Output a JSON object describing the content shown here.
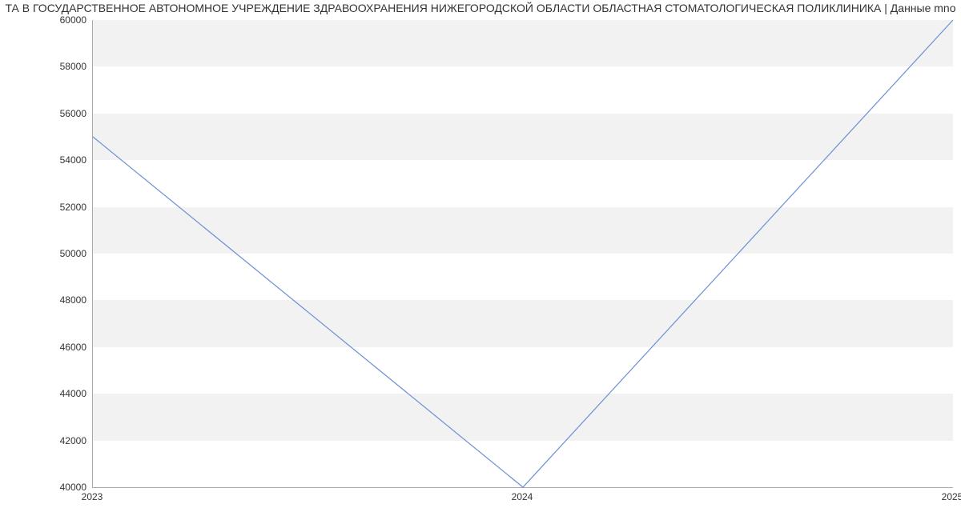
{
  "chart_data": {
    "type": "line",
    "title": "ТА В ГОСУДАРСТВЕННОЕ АВТОНОМНОЕ УЧРЕЖДЕНИЕ ЗДРАВООХРАНЕНИЯ НИЖЕГОРОДСКОЙ ОБЛАСТИ ОБЛАСТНАЯ СТОМАТОЛОГИЧЕСКАЯ ПОЛИКЛИНИКА | Данные mno",
    "x": [
      2023,
      2024,
      2025
    ],
    "values": [
      55000,
      40000,
      60000
    ],
    "xlabel": "",
    "ylabel": "",
    "xlim": [
      2023,
      2025
    ],
    "ylim": [
      40000,
      60000
    ],
    "x_ticks": [
      "2023",
      "2024",
      "2025"
    ],
    "y_ticks": [
      "40000",
      "42000",
      "44000",
      "46000",
      "48000",
      "50000",
      "52000",
      "54000",
      "56000",
      "58000",
      "60000"
    ],
    "line_color": "#6b8fd4",
    "band_color": "#f2f2f2"
  }
}
